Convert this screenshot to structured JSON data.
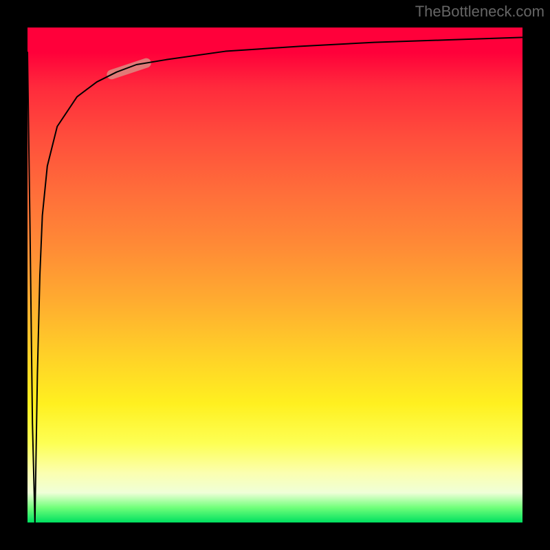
{
  "watermark": {
    "text": "TheBottleneck.com"
  },
  "chart_data": {
    "type": "line",
    "title": "",
    "xlabel": "",
    "ylabel": "",
    "xlim": [
      0,
      100
    ],
    "ylim": [
      0,
      100
    ],
    "grid": false,
    "legend": null,
    "series": [
      {
        "name": "bottleneck-curve",
        "x": [
          0,
          0.5,
          1,
          1.5,
          2,
          2.5,
          3,
          4,
          6,
          10,
          14,
          18,
          22,
          28,
          40,
          55,
          70,
          85,
          100
        ],
        "y": [
          95,
          60,
          20,
          0,
          30,
          50,
          62,
          72,
          80,
          86,
          89,
          91,
          92.5,
          93.5,
          95.2,
          96.2,
          97,
          97.5,
          98
        ]
      }
    ],
    "marker": {
      "name": "highlight-pill",
      "on_series": "bottleneck-curve",
      "x_range": [
        17,
        24
      ],
      "y_range": [
        90.5,
        93
      ]
    },
    "background_gradient": {
      "direction": "vertical",
      "stops": [
        {
          "pos": 0.0,
          "color": "#ff003a"
        },
        {
          "pos": 0.33,
          "color": "#ff6d3a"
        },
        {
          "pos": 0.66,
          "color": "#ffd028"
        },
        {
          "pos": 0.84,
          "color": "#fdff54"
        },
        {
          "pos": 0.97,
          "color": "#70ff7a"
        },
        {
          "pos": 1.0,
          "color": "#00e060"
        }
      ]
    }
  }
}
